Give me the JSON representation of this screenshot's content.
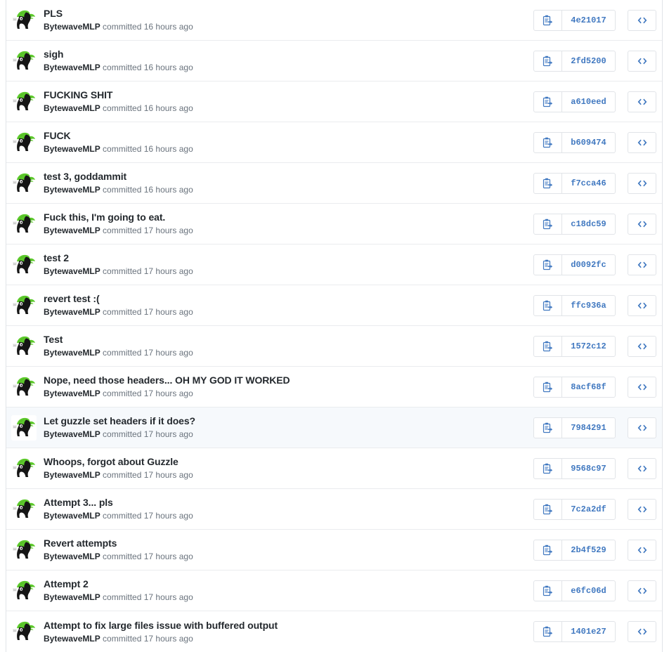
{
  "colors": {
    "link_blue": "#4078c0",
    "title_text": "#24292e",
    "meta_text": "#6a737d",
    "border": "#e1e4e8",
    "row_divider": "#eaecef",
    "row_background": "#ffffff",
    "row_highlight_background": "#f6f9fc",
    "avatar_mane_green": "#5cc92b",
    "avatar_body_black": "#151515"
  },
  "icons": {
    "copy": "clipboard-copy-icon",
    "code": "code-brackets-icon",
    "avatar": "user-avatar-pony"
  },
  "labels": {
    "committed_verb": "committed"
  },
  "commits": [
    {
      "title": "PLS",
      "author": "BytewaveMLP",
      "committed": "committed",
      "time": "16 hours ago",
      "sha": "4e21017",
      "highlight": false
    },
    {
      "title": "sigh",
      "author": "BytewaveMLP",
      "committed": "committed",
      "time": "16 hours ago",
      "sha": "2fd5200",
      "highlight": false
    },
    {
      "title": "FUCKING SHIT",
      "author": "BytewaveMLP",
      "committed": "committed",
      "time": "16 hours ago",
      "sha": "a610eed",
      "highlight": false
    },
    {
      "title": "FUCK",
      "author": "BytewaveMLP",
      "committed": "committed",
      "time": "16 hours ago",
      "sha": "b609474",
      "highlight": false
    },
    {
      "title": "test 3, goddammit",
      "author": "BytewaveMLP",
      "committed": "committed",
      "time": "16 hours ago",
      "sha": "f7cca46",
      "highlight": false
    },
    {
      "title": "Fuck this, I'm going to eat.",
      "author": "BytewaveMLP",
      "committed": "committed",
      "time": "17 hours ago",
      "sha": "c18dc59",
      "highlight": false
    },
    {
      "title": "test 2",
      "author": "BytewaveMLP",
      "committed": "committed",
      "time": "17 hours ago",
      "sha": "d0092fc",
      "highlight": false
    },
    {
      "title": "revert test :(",
      "author": "BytewaveMLP",
      "committed": "committed",
      "time": "17 hours ago",
      "sha": "ffc936a",
      "highlight": false
    },
    {
      "title": "Test",
      "author": "BytewaveMLP",
      "committed": "committed",
      "time": "17 hours ago",
      "sha": "1572c12",
      "highlight": false
    },
    {
      "title": "Nope, need those headers... OH MY GOD IT WORKED",
      "author": "BytewaveMLP",
      "committed": "committed",
      "time": "17 hours ago",
      "sha": "8acf68f",
      "highlight": false
    },
    {
      "title": "Let guzzle set headers if it does?",
      "author": "BytewaveMLP",
      "committed": "committed",
      "time": "17 hours ago",
      "sha": "7984291",
      "highlight": true
    },
    {
      "title": "Whoops, forgot about Guzzle",
      "author": "BytewaveMLP",
      "committed": "committed",
      "time": "17 hours ago",
      "sha": "9568c97",
      "highlight": false
    },
    {
      "title": "Attempt 3... pls",
      "author": "BytewaveMLP",
      "committed": "committed",
      "time": "17 hours ago",
      "sha": "7c2a2df",
      "highlight": false
    },
    {
      "title": "Revert attempts",
      "author": "BytewaveMLP",
      "committed": "committed",
      "time": "17 hours ago",
      "sha": "2b4f529",
      "highlight": false
    },
    {
      "title": "Attempt 2",
      "author": "BytewaveMLP",
      "committed": "committed",
      "time": "17 hours ago",
      "sha": "e6fc06d",
      "highlight": false
    },
    {
      "title": "Attempt to fix large files issue with buffered output",
      "author": "BytewaveMLP",
      "committed": "committed",
      "time": "17 hours ago",
      "sha": "1401e27",
      "highlight": false
    }
  ]
}
